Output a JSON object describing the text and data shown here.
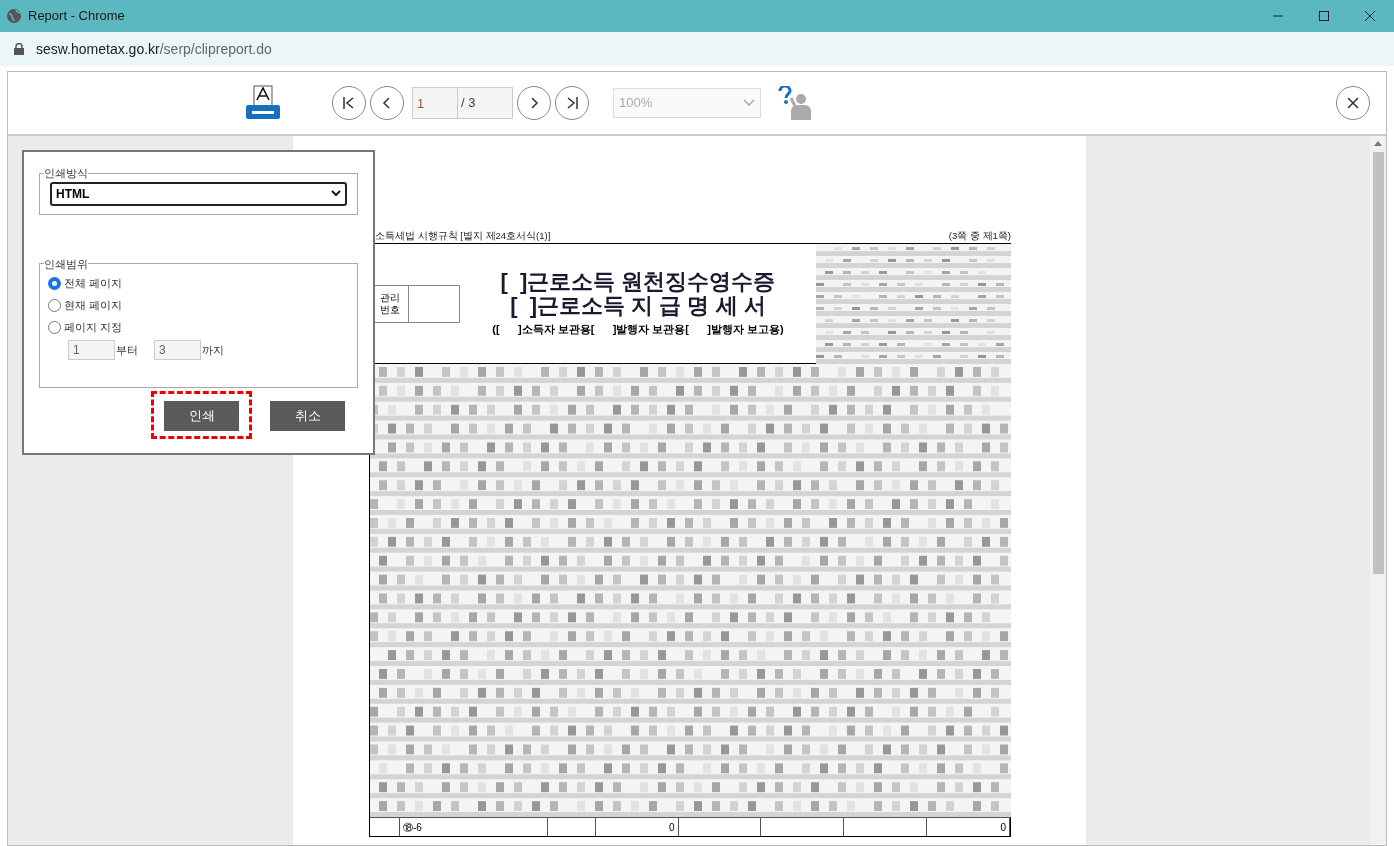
{
  "window": {
    "title": "Report - Chrome"
  },
  "address_bar": {
    "host": "sesw.hometax.go.kr",
    "path": "/serp/clipreport.do"
  },
  "toolbar": {
    "page": "1",
    "page_total": "/ 3",
    "zoom": "100%",
    "zoom_disabled": true
  },
  "print_dialog": {
    "method_legend": "인쇄방식",
    "method": "HTML",
    "range_legend": "인쇄범위",
    "range_options": [
      {
        "label": "전체 페이지",
        "selected": true
      },
      {
        "label": "현재 페이지",
        "selected": false
      },
      {
        "label": "페이지 지정",
        "selected": false
      }
    ],
    "from": "1",
    "from_label": "부터",
    "to": "3",
    "to_label": "까지",
    "buttons": [
      {
        "label": "인쇄",
        "highlighted": true
      },
      {
        "label": "취소",
        "highlighted": false
      }
    ]
  },
  "document": {
    "form_ref": "소득세법 시행규칙 [별지 제24호서식(1)]",
    "page_note": "(3쪽 중 제1쪽)",
    "id_label": "관리 번호",
    "titles": [
      "[  ]근로소득 원천징수영수증",
      "[  ]근로소득 지 급 명 세 서"
    ],
    "copies": "([      ]소득자 보관용[      ]발행자 보관용[      ]발행자 보고용)",
    "last_row": {
      "label": "⑱-6",
      "values": [
        "0",
        "0"
      ]
    }
  }
}
